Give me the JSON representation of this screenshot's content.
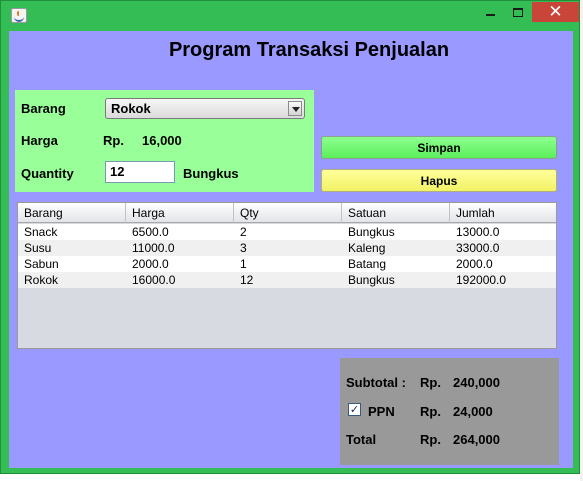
{
  "window": {
    "title": "",
    "controls": {
      "minimize": "minimize-icon",
      "maximize": "maximize-icon",
      "close": "✕"
    }
  },
  "app": {
    "title": "Program Transaksi Penjualan"
  },
  "form": {
    "barang_label": "Barang",
    "barang_value": "Rokok",
    "harga_label": "Harga",
    "harga_currency": "Rp.",
    "harga_value": "16,000",
    "quantity_label": "Quantity",
    "quantity_value": "12",
    "unit": "Bungkus"
  },
  "buttons": {
    "simpan": "Simpan",
    "hapus": "Hapus"
  },
  "table": {
    "columns": [
      "Barang",
      "Harga",
      "Qty",
      "Satuan",
      "Jumlah"
    ],
    "rows": [
      [
        "Snack",
        "6500.0",
        "2",
        "Bungkus",
        "13000.0"
      ],
      [
        "Susu",
        "11000.0",
        "3",
        "Kaleng",
        "33000.0"
      ],
      [
        "Sabun",
        "2000.0",
        "1",
        "Batang",
        "2000.0"
      ],
      [
        "Rokok",
        "16000.0",
        "12",
        "Bungkus",
        "192000.0"
      ]
    ]
  },
  "summary": {
    "subtotal_label": "Subtotal :",
    "subtotal_currency": "Rp.",
    "subtotal_value": "240,000",
    "ppn_label": "PPN",
    "ppn_checked": true,
    "ppn_check_glyph": "✓",
    "ppn_currency": "Rp.",
    "ppn_value": "24,000",
    "total_label": "Total",
    "total_currency": "Rp.",
    "total_value": "264,000"
  },
  "colors": {
    "title_bar": "#35bd55",
    "content_bg": "#9999ff",
    "input_panel_bg": "#99ff99",
    "simpan_button": "#66ff66",
    "hapus_button": "#ffff66",
    "summary_bg": "#999999",
    "close_button": "#c9453a"
  }
}
